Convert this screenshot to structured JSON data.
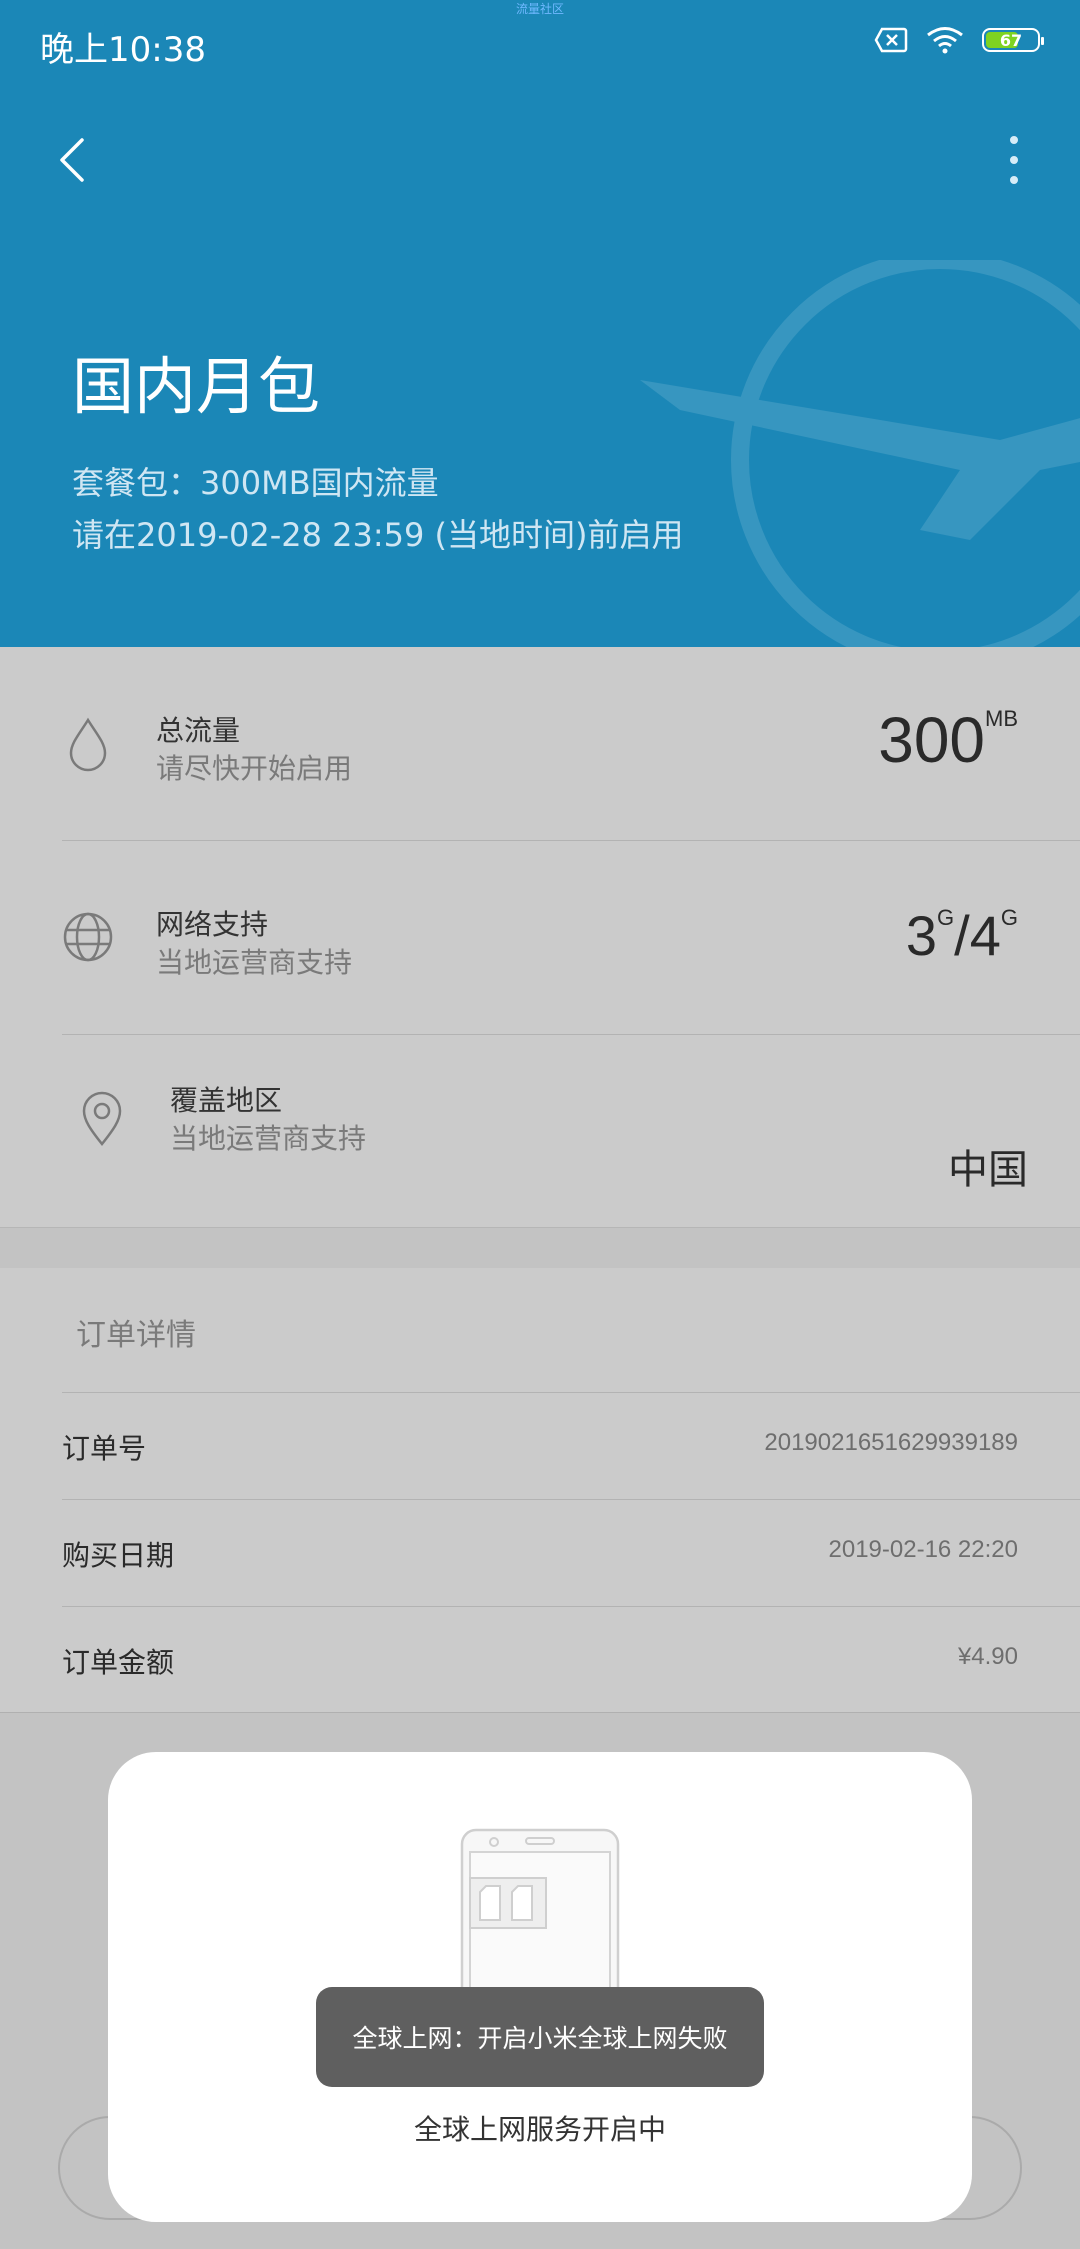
{
  "status_bar": {
    "time": "晚上10:38",
    "top_tiny": "流量社区",
    "battery": "67"
  },
  "header": {
    "title": "国内月包",
    "sub1": "套餐包：300MB国内流量",
    "sub2": "请在2019-02-28 23:59 (当地时间)前启用"
  },
  "info": [
    {
      "label": "总流量",
      "sub": "请尽快开始启用",
      "value": "300",
      "unit": "MB"
    },
    {
      "label": "网络支持",
      "sub": "当地运营商支持",
      "v1": "3",
      "u1": "G",
      "sep": "/",
      "v2": "4",
      "u2": "G"
    },
    {
      "label": "覆盖地区",
      "sub": "当地运营商支持",
      "value": "中国"
    }
  ],
  "order": {
    "header": "订单详情",
    "rows": [
      {
        "label": "订单号",
        "value": "2019021651629939189"
      },
      {
        "label": "购买日期",
        "value": "2019-02-16 22:20"
      },
      {
        "label": "订单金额",
        "value": "¥4.90"
      }
    ]
  },
  "dialog": {
    "text": "全球上网服务开启中"
  },
  "toast": {
    "text": "全球上网：开启小米全球上网失败"
  },
  "colors": {
    "header_bg": "#1b87b7",
    "overlay_gray": "#c9c9c9",
    "battery_fill": "#7ed321"
  }
}
